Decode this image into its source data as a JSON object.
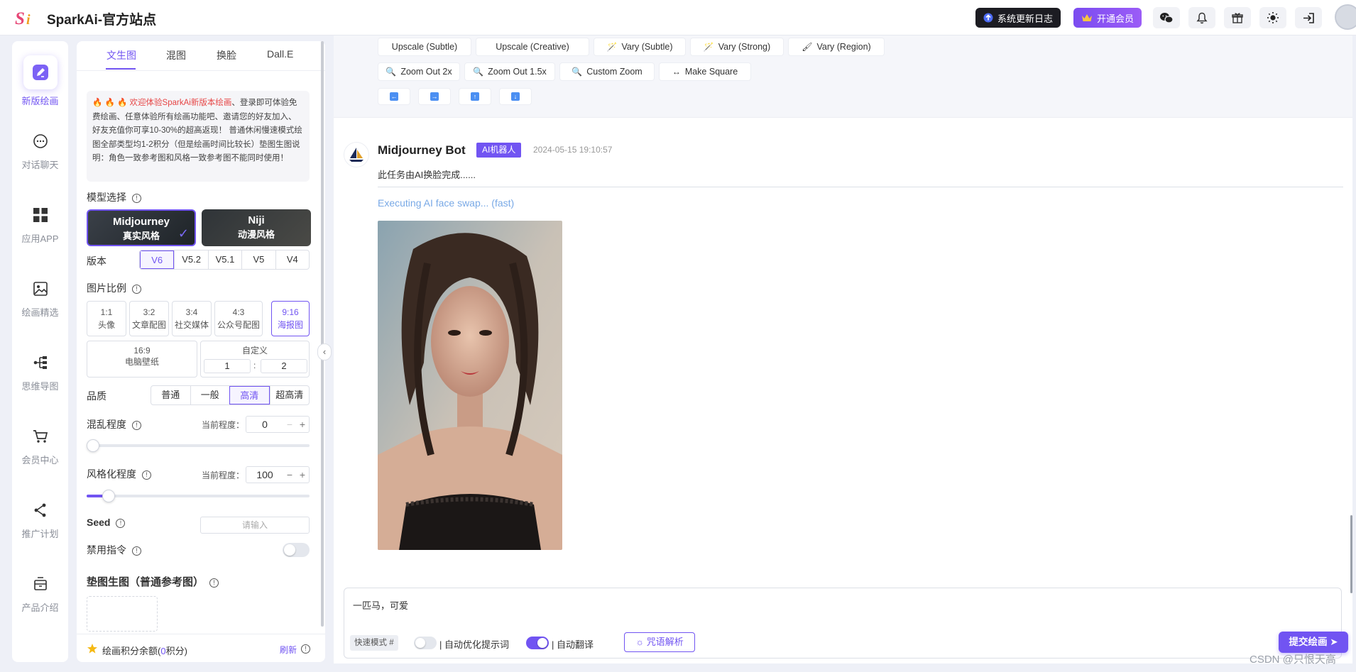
{
  "header": {
    "site_title": "SparkAi-官方站点",
    "changelog_label": "系统更新日志",
    "vip_label": "开通会员",
    "icons": [
      "wechat-icon",
      "bell-icon",
      "gift-icon",
      "sun-icon",
      "logout-icon"
    ]
  },
  "nav": {
    "items": [
      {
        "label": "新版绘画",
        "icon": "pen-icon",
        "active": true
      },
      {
        "label": "对话聊天",
        "icon": "chat-icon"
      },
      {
        "label": "应用APP",
        "icon": "grid-icon"
      },
      {
        "label": "绘画精选",
        "icon": "image-icon"
      },
      {
        "label": "思维导图",
        "icon": "mindmap-icon"
      },
      {
        "label": "会员中心",
        "icon": "cart-icon"
      },
      {
        "label": "推广计划",
        "icon": "share-icon"
      },
      {
        "label": "产品介绍",
        "icon": "box-icon"
      }
    ]
  },
  "panel": {
    "tabs": [
      "文生图",
      "混图",
      "换脸",
      "Dall.E"
    ],
    "notice_highlight": "欢迎体验SparkAi新版本绘画",
    "notice_text": "、登录即可体验免费绘画、任意体验所有绘画功能吧、邀请您的好友加入、好友充值你可享10-30%的超高返现！ 普通休闲慢速模式绘图全部类型均1-2积分（但是绘画时间比较长）垫图生图说明：角色一致参考图和风格一致参考图不能同时使用！",
    "model_label": "模型选择",
    "models": [
      {
        "name": "Midjourney",
        "sub": "真实风格",
        "selected": true
      },
      {
        "name": "Niji",
        "sub": "动漫风格"
      }
    ],
    "version_label": "版本",
    "versions": [
      "V6",
      "V5.2",
      "V5.1",
      "V5",
      "V4"
    ],
    "version_selected": "V6",
    "ratio_label": "图片比例",
    "ratios": [
      {
        "r": "1:1",
        "d": "头像"
      },
      {
        "r": "3:2",
        "d": "文章配图"
      },
      {
        "r": "3:4",
        "d": "社交媒体"
      },
      {
        "r": "4:3",
        "d": "公众号配图"
      },
      {
        "r": "9:16",
        "d": "海报图",
        "selected": true
      }
    ],
    "ratio_169": {
      "r": "16:9",
      "d": "电脑壁纸"
    },
    "custom_label": "自定义",
    "custom_w": "1",
    "custom_sep": ":",
    "custom_h": "2",
    "quality_label": "品质",
    "qualities": [
      "普通",
      "一般",
      "高清",
      "超高清"
    ],
    "quality_selected": "高清",
    "chaos_label": "混乱程度",
    "chaos_current_label": "当前程度：",
    "chaos_value": "0",
    "chaos_fraction": 0,
    "stylize_label": "风格化程度",
    "stylize_current_label": "当前程度：",
    "stylize_value": "100",
    "stylize_fraction": 0.1,
    "seed_label": "Seed",
    "seed_placeholder": "请输入",
    "disable_cmd_label": "禁用指令",
    "disable_cmd_on": false,
    "ref_label": "垫图生图（普通参考图）",
    "footer_balance_prefix": "绘画积分余额(",
    "footer_balance_value": "0",
    "footer_balance_suffix": "积分)",
    "footer_refresh": "刷新"
  },
  "main": {
    "actions_row1": [
      "Upscale (Subtle)",
      "Upscale (Creative)",
      "Vary (Subtle)",
      "Vary (Strong)",
      "Vary (Region)"
    ],
    "actions_row2": [
      "Zoom Out 2x",
      "Zoom Out 1.5x",
      "Custom Zoom",
      "Make Square"
    ],
    "arrows": [
      "←",
      "→",
      "↑",
      "↓"
    ],
    "bot_name": "Midjourney Bot",
    "bot_badge": "AI机器人",
    "bot_time": "2024-05-15 19:10:57",
    "bot_message": "此任务由AI换脸完成......",
    "executing": "Executing AI face swap... (fast)",
    "composer_text": "一匹马，可爱",
    "mode_chip": "快速模式 #",
    "auto_optimize_label": "自动优化提示词",
    "auto_optimize_on": false,
    "auto_translate_label": "自动翻译",
    "auto_translate_on": true,
    "parse_label": "咒语解析",
    "submit_label": "提交绘画"
  },
  "watermark": "CSDN @只恨天高",
  "colors": {
    "accent": "#7154f2",
    "highlight_red": "#e64545",
    "exec_blue": "#79a9e6"
  }
}
